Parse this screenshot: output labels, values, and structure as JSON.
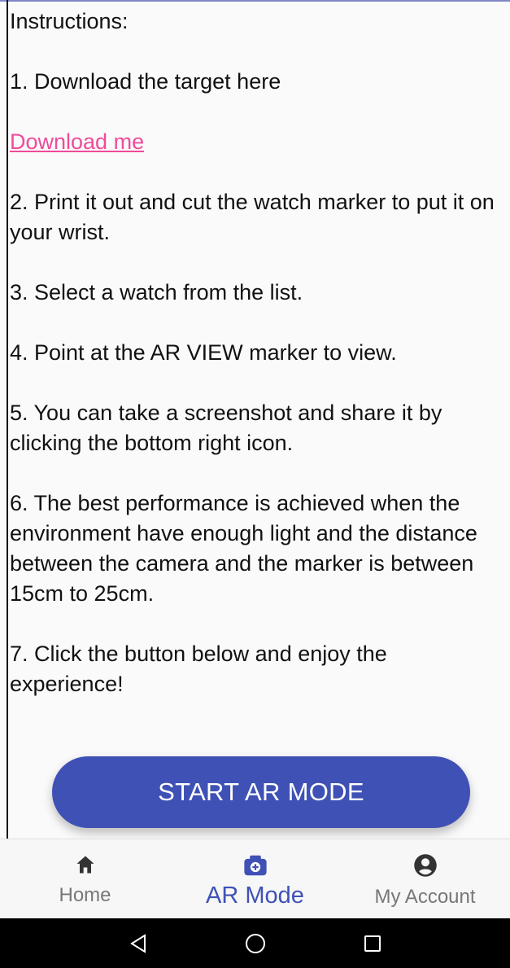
{
  "instructions": {
    "title": "Instructions:",
    "step1": "1. Download the target here",
    "download_link": "Download me",
    "step2": "2. Print it out and cut the watch marker to put it on your wrist.",
    "step3": "3. Select a watch from the list.",
    "step4": "4. Point at the AR VIEW marker to view.",
    "step5": "5. You can take a screenshot and share it by clicking the bottom right icon.",
    "step6": "6. The best performance is achieved when the environment have enough light and the distance between the camera and the marker is between 15cm to 25cm.",
    "step7": "7. Click the button below and enjoy the experience!"
  },
  "start_button": {
    "label": "START AR MODE"
  },
  "bottom_nav": {
    "items": [
      {
        "label": "Home",
        "icon": "home-icon"
      },
      {
        "label": "AR Mode",
        "icon": "camera-icon",
        "active": true
      },
      {
        "label": "My Account",
        "icon": "account-icon"
      }
    ]
  },
  "system_nav": {
    "buttons": [
      "back-icon",
      "home-circle-icon",
      "recent-apps-icon"
    ]
  },
  "colors": {
    "accent": "#3f51b5",
    "link": "#f04b9a",
    "text": "#111111",
    "inactive": "#777777",
    "system_bar": "#000000"
  }
}
